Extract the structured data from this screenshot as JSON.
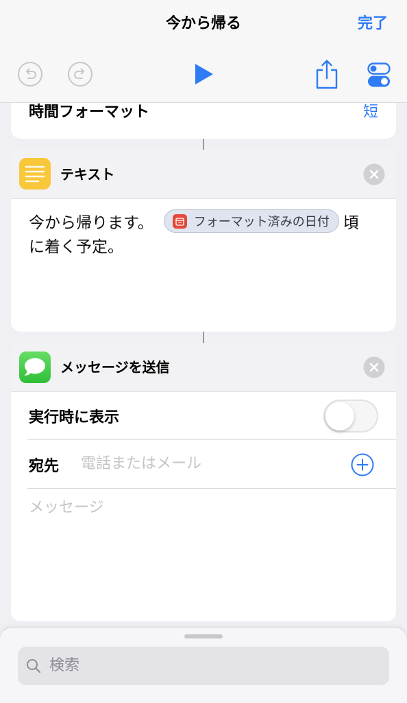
{
  "nav": {
    "title": "今から帰る",
    "done": "完了"
  },
  "toolbar": {
    "icons": [
      "undo-icon",
      "redo-icon",
      "play-icon",
      "share-icon",
      "settings-toggle-icon"
    ]
  },
  "actions": {
    "time_format": {
      "label": "時間フォーマット",
      "value": "短"
    },
    "text": {
      "title": "テキスト",
      "icon": "text-icon",
      "close_icon": "close-icon",
      "text_before": "今から帰ります。",
      "token": {
        "label": "フォーマット済みの日付",
        "icon": "calendar-icon"
      },
      "text_after": "頃",
      "text_line2": "に着く予定。"
    },
    "send_message": {
      "title": "メッセージを送信",
      "icon": "messages-icon",
      "close_icon": "close-icon",
      "show_when_run": {
        "label": "実行時に表示",
        "enabled": false
      },
      "recipients": {
        "label": "宛先",
        "placeholder": "電話またはメール",
        "add_icon": "plus-circle-icon"
      },
      "message": {
        "placeholder": "メッセージ"
      }
    }
  },
  "search": {
    "placeholder": "検索",
    "icon": "search-icon"
  },
  "colors": {
    "accent": "#2f7bf5",
    "text_action_icon": "#f8c73a",
    "messages_action_icon": "#3fc83f",
    "date_token_icon": "#e4483b"
  }
}
